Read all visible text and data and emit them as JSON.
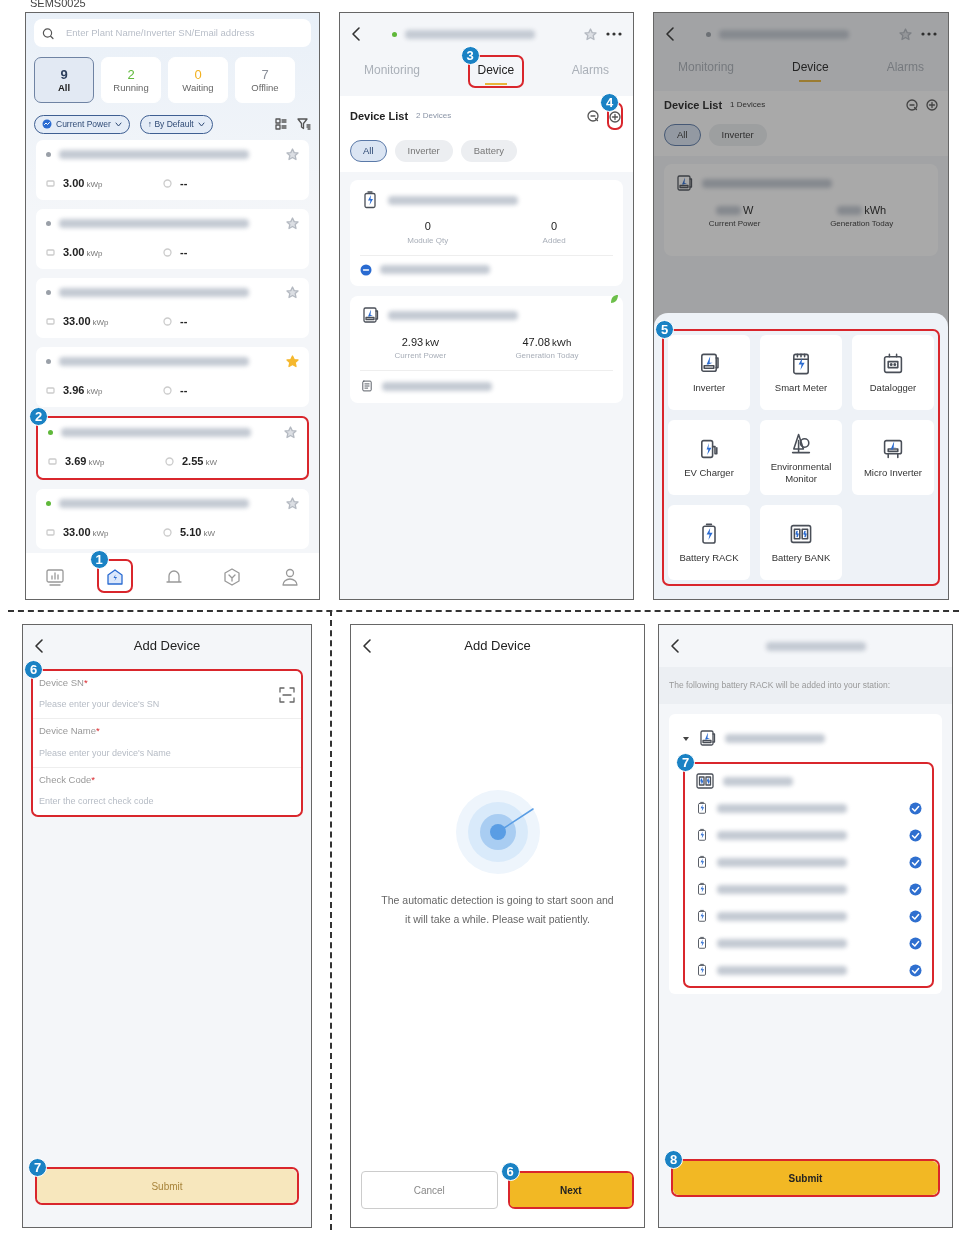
{
  "caption": "SEMS0025",
  "plant_list": {
    "search": {
      "placeholder": "Enter Plant Name/Inverter SN/Email address"
    },
    "status_tabs": [
      {
        "count": "9",
        "label": "All",
        "selected": true,
        "color": "#2c3e5c"
      },
      {
        "count": "2",
        "label": "Running",
        "selected": false,
        "color": "#5fb83a"
      },
      {
        "count": "0",
        "label": "Waiting",
        "selected": false,
        "color": "#f2b01e"
      },
      {
        "count": "7",
        "label": "Offline",
        "selected": false,
        "color": "#8a8f99"
      }
    ],
    "sort_chips": [
      {
        "label": "Current Power",
        "kind": "metric"
      },
      {
        "label": "↑ By Default",
        "kind": "order"
      }
    ],
    "plants": [
      {
        "color": "#9aa0a8",
        "capacity": "3.00",
        "capacity_unit": "kWp",
        "power": "--",
        "favorite": false
      },
      {
        "color": "#9aa0a8",
        "capacity": "3.00",
        "capacity_unit": "kWp",
        "power": "--",
        "favorite": false
      },
      {
        "color": "#9aa0a8",
        "capacity": "33.00",
        "capacity_unit": "kWp",
        "power": "--",
        "favorite": false
      },
      {
        "color": "#9aa0a8",
        "capacity": "3.96",
        "capacity_unit": "kWp",
        "power": "--",
        "favorite": true
      },
      {
        "color": "#5fb83a",
        "capacity": "3.69",
        "capacity_unit": "kWp",
        "power": "2.55",
        "power_unit": "kW",
        "favorite": false,
        "callout": "2"
      },
      {
        "color": "#5fb83a",
        "capacity": "33.00",
        "capacity_unit": "kWp",
        "power": "5.10",
        "power_unit": "kW",
        "favorite": false
      }
    ],
    "bottom_nav": [
      {
        "kind": "stats",
        "selected": false
      },
      {
        "kind": "plant",
        "selected": true,
        "callout": "1"
      },
      {
        "kind": "alarm",
        "selected": false
      },
      {
        "kind": "discover",
        "selected": false
      },
      {
        "kind": "profile",
        "selected": false
      }
    ]
  },
  "plant_detail": {
    "online": true,
    "favorite": false,
    "tabs": [
      {
        "label": "Monitoring",
        "selected": false
      },
      {
        "label": "Device",
        "selected": true,
        "callout": "3"
      },
      {
        "label": "Alarms",
        "selected": false
      }
    ],
    "device_list": {
      "title": "Device List",
      "count": "2 Devices",
      "add_callout": "4"
    },
    "filters": [
      {
        "label": "All",
        "selected": true
      },
      {
        "label": "Inverter",
        "selected": false
      },
      {
        "label": "Battery",
        "selected": false
      }
    ],
    "devices": [
      {
        "kind": "battery",
        "online": false,
        "stats": [
          {
            "value": "0",
            "label": "Module Qty"
          },
          {
            "value": "0",
            "label": "Added"
          }
        ]
      },
      {
        "kind": "inverter",
        "online": true,
        "stats": [
          {
            "value": "2.93",
            "unit": "kW",
            "label": "Current Power"
          },
          {
            "value": "47.08",
            "unit": "kWh",
            "label": "Generation Today"
          }
        ]
      }
    ]
  },
  "add_device_menu": {
    "tabs": [
      {
        "label": "Monitoring",
        "selected": false
      },
      {
        "label": "Device",
        "selected": true
      },
      {
        "label": "Alarms",
        "selected": false
      }
    ],
    "device_list": {
      "title": "Device List",
      "count": "1 Devices"
    },
    "filters": [
      {
        "label": "All",
        "selected": true
      },
      {
        "label": "Inverter",
        "selected": false
      }
    ],
    "device": {
      "stats": [
        {
          "unit": "W",
          "label": "Current Power"
        },
        {
          "unit": "kWh",
          "label": "Generation Today"
        }
      ]
    },
    "callout": "5",
    "options": [
      {
        "label": "Inverter",
        "kind": "inverter"
      },
      {
        "label": "Smart Meter",
        "kind": "meter"
      },
      {
        "label": "Datalogger",
        "kind": "datalogger"
      },
      {
        "label": "EV Charger",
        "kind": "ev"
      },
      {
        "label": "Environmental Monitor",
        "kind": "env"
      },
      {
        "label": "Micro Inverter",
        "kind": "micro"
      },
      {
        "label": "Battery RACK",
        "kind": "rack"
      },
      {
        "label": "Battery BANK",
        "kind": "bank"
      }
    ]
  },
  "add_device_form": {
    "title": "Add Device",
    "callout": "6",
    "fields": [
      {
        "label": "Device SN",
        "required_mark": "*",
        "placeholder": "Please enter your device's SN",
        "scan": true
      },
      {
        "label": "Device Name",
        "required_mark": "*",
        "placeholder": "Please enter your device's Name",
        "scan": false
      },
      {
        "label": "Check Code",
        "required_mark": "*",
        "placeholder": "Enter the correct check code",
        "scan": false
      }
    ],
    "submit": {
      "label": "Submit",
      "disabled": true,
      "callout": "7"
    }
  },
  "auto_detection": {
    "title": "Add Device",
    "message": "The automatic detection is going to start soon and it will take a while. Please wait patiently.",
    "cancel": {
      "label": "Cancel"
    },
    "next": {
      "label": "Next",
      "callout": "6"
    }
  },
  "battery_rack_confirm": {
    "notice": "The following battery RACK will be added into your station:",
    "tree": {
      "expanded": true,
      "children": [
        {
          "kind": "bank",
          "callout": "7",
          "children": [
            {
              "checked": true
            },
            {
              "checked": true
            },
            {
              "checked": true
            },
            {
              "checked": true
            },
            {
              "checked": true
            },
            {
              "checked": true
            },
            {
              "checked": true
            }
          ]
        }
      ]
    },
    "submit": {
      "label": "Submit",
      "callout": "8"
    }
  }
}
